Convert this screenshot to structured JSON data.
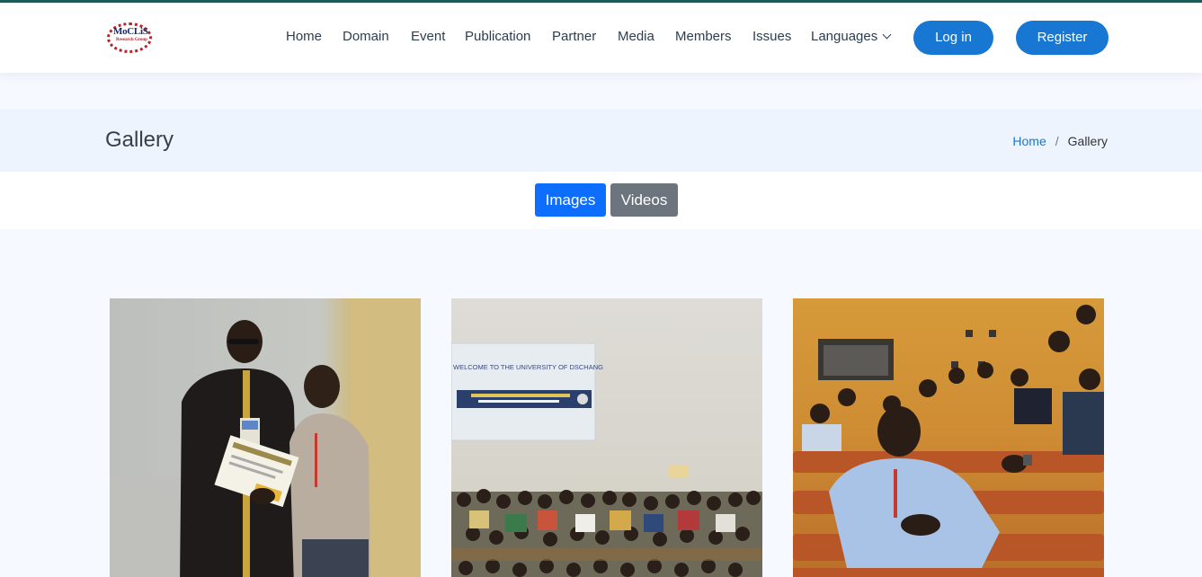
{
  "brand": {
    "logo_text": "MoCLiS",
    "logo_sub": "Research Group"
  },
  "nav": {
    "items": [
      "Home",
      "Domain",
      "Event",
      "Publication",
      "Partner",
      "Media",
      "Members",
      "Issues",
      "Languages"
    ],
    "login": "Log in",
    "register": "Register"
  },
  "page": {
    "title": "Gallery"
  },
  "breadcrumb": {
    "home": "Home",
    "separator": "/",
    "current": "Gallery"
  },
  "tabs": {
    "images": "Images",
    "videos": "Videos"
  },
  "gallery": {
    "photos": [
      {
        "kind": "certificate-handover"
      },
      {
        "kind": "group-photo",
        "screen_text": "WELCOME TO THE UNIVERSITY OF DSCHANG"
      },
      {
        "kind": "lecture-hall-audience"
      }
    ]
  },
  "colors": {
    "accent": "#1877d3",
    "tab_active": "#0d6efd",
    "tab_inactive": "#6c757d",
    "title_band": "#eef4fd"
  }
}
